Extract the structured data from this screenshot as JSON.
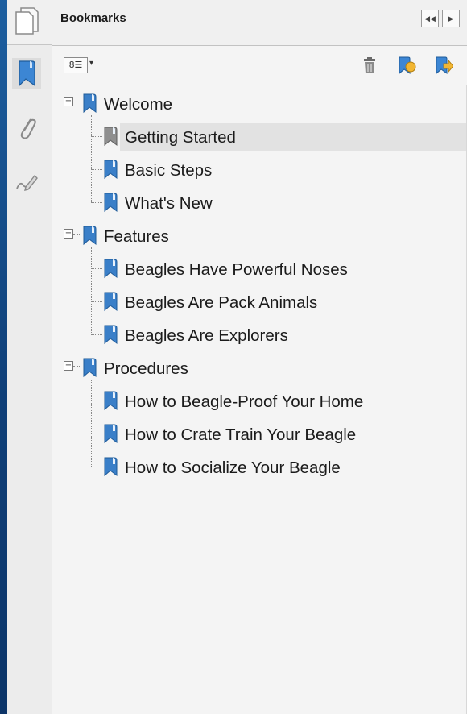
{
  "panel": {
    "title": "Bookmarks",
    "collapse_glyph": "◀◀",
    "expand_glyph": "▶"
  },
  "toolbar": {
    "options_glyph": "8☰",
    "options_caret": "▾",
    "delete_icon": "trash-icon",
    "new_bookmark_icon": "new-bookmark-icon",
    "expand_bookmark_icon": "expand-bookmark-icon"
  },
  "nav_rail": {
    "items": [
      {
        "icon": "page-thumbnails-icon"
      },
      {
        "icon": "bookmarks-icon",
        "active": true
      },
      {
        "icon": "attachments-icon"
      },
      {
        "icon": "signatures-icon"
      }
    ]
  },
  "bookmarks": [
    {
      "label": "Welcome",
      "children": [
        {
          "label": "Getting Started",
          "selected": true
        },
        {
          "label": "Basic Steps"
        },
        {
          "label": "What's New"
        }
      ]
    },
    {
      "label": "Features",
      "children": [
        {
          "label": "Beagles Have Powerful Noses"
        },
        {
          "label": "Beagles Are Pack Animals"
        },
        {
          "label": "Beagles Are Explorers"
        }
      ]
    },
    {
      "label": "Procedures",
      "children": [
        {
          "label": "How to Beagle-Proof Your Home"
        },
        {
          "label": "How to Crate Train Your Beagle"
        },
        {
          "label": "How to Socialize Your Beagle"
        }
      ]
    }
  ],
  "colors": {
    "desktop": "#1d5fa0",
    "panel_bg": "#f4f4f4",
    "bookmark_blue": "#3a7fc8",
    "selected_row": "#e2e2e2"
  }
}
